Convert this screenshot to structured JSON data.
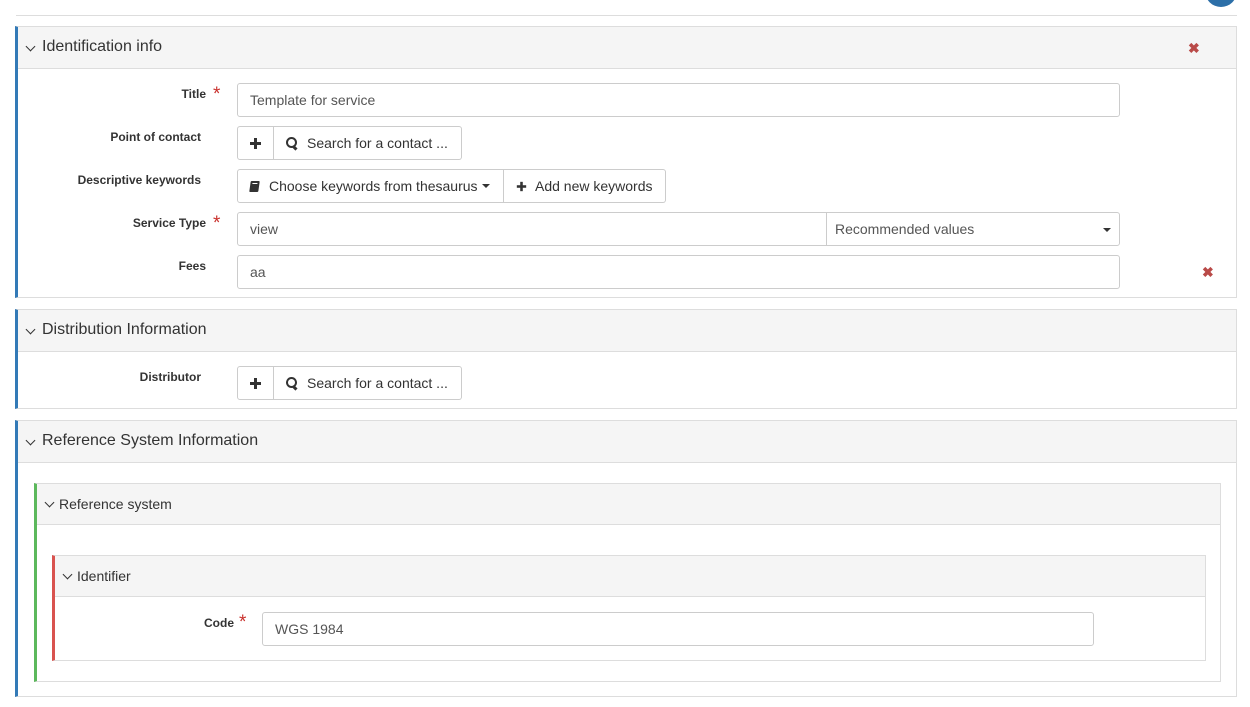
{
  "identification": {
    "title": "Identification info",
    "fields": {
      "title_label": "Title",
      "title_value": "Template for service",
      "poc_label": "Point of contact",
      "keywords_label": "Descriptive keywords",
      "service_type_label": "Service Type",
      "service_type_value": "view",
      "fees_label": "Fees",
      "fees_value": "aa"
    },
    "contact_search_label": "Search for a contact ...",
    "choose_keywords_label": "Choose keywords from thesaurus",
    "add_keywords_label": "Add new keywords",
    "recommended_values": "Recommended values"
  },
  "distribution": {
    "title": "Distribution Information",
    "distributor_label": "Distributor",
    "contact_search_label": "Search for a contact ..."
  },
  "reference_system": {
    "title": "Reference System Information",
    "sub_title": "Reference system",
    "identifier_title": "Identifier",
    "code_label": "Code",
    "code_value": "WGS 1984"
  },
  "icons": {
    "required": "*",
    "close": "✖",
    "collapse": "chevron-down-icon"
  },
  "colors": {
    "panel_accent": "#337ab7",
    "subpanel_accent": "#5cb85c",
    "identifier_accent": "#d9534f",
    "required": "#c9302c",
    "remove": "#b94a48"
  }
}
